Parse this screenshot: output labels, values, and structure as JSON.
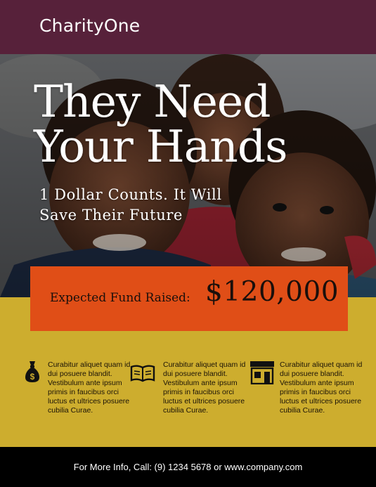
{
  "header": {
    "brand": "CharityOne"
  },
  "hero": {
    "headline_line1": "They Need",
    "headline_line2": "Your Hands",
    "subhead_line1": "1 Dollar Counts. It Will",
    "subhead_line2": "Save Their Future"
  },
  "fund": {
    "label": "Expected Fund Raised:",
    "amount": "$120,000"
  },
  "features": [
    {
      "icon": "money-bag-icon",
      "text": "Curabitur aliquet quam id dui posuere blandit. Vestibulum ante ipsum primis in faucibus orci luctus et ultrices posuere cubilia Curae."
    },
    {
      "icon": "open-book-icon",
      "text": "Curabitur aliquet quam id dui posuere blandit. Vestibulum ante ipsum primis in faucibus orci luctus et ultrices posuere cubilia Curae."
    },
    {
      "icon": "store-icon",
      "text": "Curabitur aliquet quam id dui posuere blandit. Vestibulum ante ipsum primis in faucibus orci luctus et ultrices posuere cubilia Curae."
    }
  ],
  "footer": {
    "contact": "For More Info, Call: (9) 1234 5678 or www.company.com"
  },
  "colors": {
    "header_bg": "#57213a",
    "fund_bg": "#e04e17",
    "info_bg": "#cdad2e",
    "footer_bg": "#000000"
  }
}
